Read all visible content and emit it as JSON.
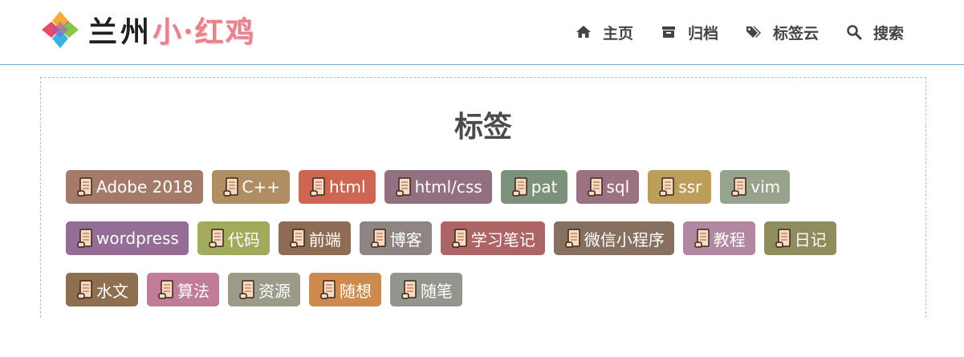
{
  "site": {
    "logo_text_part1": "兰州",
    "logo_text_part2": "小·红鸡",
    "logo_colors": [
      "#e64c66",
      "#f7a93a",
      "#3bb2e6",
      "#8ac34a",
      "#8c5cc8"
    ]
  },
  "nav": {
    "items": [
      {
        "label": "主页",
        "icon": "home-icon"
      },
      {
        "label": "归档",
        "icon": "archive-icon"
      },
      {
        "label": "标签云",
        "icon": "tags-icon"
      },
      {
        "label": "搜索",
        "icon": "search-icon"
      }
    ]
  },
  "page": {
    "title": "标签"
  },
  "tags": {
    "icon": "scroll-icon",
    "rows": [
      [
        {
          "label": "Adobe 2018",
          "color": "#a47a6a"
        },
        {
          "label": "C++",
          "color": "#b08e63"
        },
        {
          "label": "html",
          "color": "#cc6652"
        },
        {
          "label": "html/css",
          "color": "#92707f"
        },
        {
          "label": "pat",
          "color": "#7c9179"
        },
        {
          "label": "sql",
          "color": "#9a7282"
        },
        {
          "label": "ssr",
          "color": "#bd9d5a"
        },
        {
          "label": "vim",
          "color": "#98a38d"
        }
      ],
      [
        {
          "label": "wordpress",
          "color": "#936d95"
        },
        {
          "label": "代码",
          "color": "#a2ab5c"
        },
        {
          "label": "前端",
          "color": "#8e6b53"
        },
        {
          "label": "博客",
          "color": "#8e8582"
        },
        {
          "label": "学习笔记",
          "color": "#ad6464"
        },
        {
          "label": "微信小程序",
          "color": "#87705f"
        },
        {
          "label": "教程",
          "color": "#b288a0"
        },
        {
          "label": "日记",
          "color": "#8e8b5c"
        }
      ],
      [
        {
          "label": "水文",
          "color": "#8e6f4f"
        },
        {
          "label": "算法",
          "color": "#c17c98"
        },
        {
          "label": "资源",
          "color": "#9c9b8a"
        },
        {
          "label": "随想",
          "color": "#cc8a4e"
        },
        {
          "label": "随笔",
          "color": "#93968d"
        }
      ]
    ]
  }
}
